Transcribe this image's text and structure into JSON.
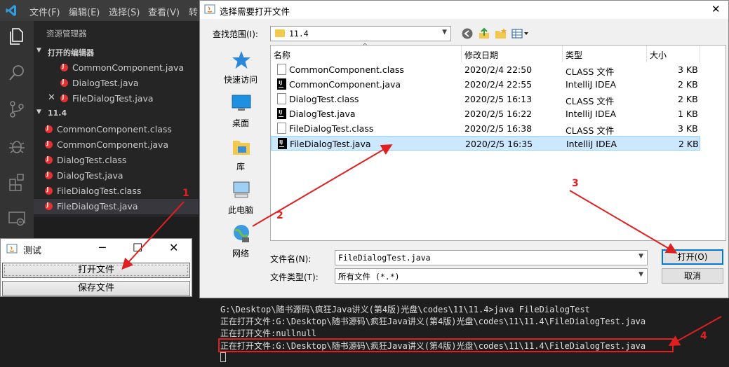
{
  "vscode": {
    "menu": [
      "文件(F)",
      "编辑(E)",
      "选择(S)",
      "查看(V)",
      "转"
    ],
    "explorer_title": "资源管理器",
    "open_editors": {
      "header": "打开的编辑器",
      "files": [
        "CommonComponent.java",
        "DialogTest.java",
        "FileDialogTest.java"
      ]
    },
    "folder": {
      "header": "11.4",
      "files": [
        "CommonComponent.class",
        "CommonComponent.java",
        "DialogTest.class",
        "DialogTest.java",
        "FileDialogTest.class",
        "FileDialogTest.java"
      ]
    },
    "terminal": [
      "G:\\Desktop\\随书源码\\疯狂Java讲义(第4版)光盘\\codes\\11\\11.4>java FileDialogTest",
      "正在打开文件:G:\\Desktop\\随书源码\\疯狂Java讲义(第4版)光盘\\codes\\11\\11.4\\FileDialogTest.java",
      "正在打开文件:nullnull",
      "正在打开文件:G:\\Desktop\\随书源码\\疯狂Java讲义(第4版)光盘\\codes\\11\\11.4\\FileDialogTest.java"
    ]
  },
  "mini": {
    "title": "测试",
    "controls": [
      "─",
      "☐",
      "✕"
    ],
    "open_label": "打开文件",
    "save_label": "保存文件"
  },
  "dialog": {
    "title": "选择需要打开文件",
    "close": "✕",
    "look_in_label": "查找范围(I):",
    "look_in_value": "11.4",
    "places": [
      "快速访问",
      "桌面",
      "库",
      "此电脑",
      "网络"
    ],
    "columns": [
      "名称",
      "修改日期",
      "类型",
      "大小"
    ],
    "files": [
      {
        "name": "CommonComponent.class",
        "date": "2020/2/4 22:50",
        "type": "CLASS 文件",
        "size": "3 KB",
        "icon": "doc"
      },
      {
        "name": "CommonComponent.java",
        "date": "2020/2/4 22:55",
        "type": "IntelliJ IDEA",
        "size": "2 KB",
        "icon": "ij"
      },
      {
        "name": "DialogTest.class",
        "date": "2020/2/5 16:13",
        "type": "CLASS 文件",
        "size": "2 KB",
        "icon": "doc"
      },
      {
        "name": "DialogTest.java",
        "date": "2020/2/5 16:22",
        "type": "IntelliJ IDEA",
        "size": "1 KB",
        "icon": "ij"
      },
      {
        "name": "FileDialogTest.class",
        "date": "2020/2/5 16:38",
        "type": "CLASS 文件",
        "size": "3 KB",
        "icon": "doc"
      },
      {
        "name": "FileDialogTest.java",
        "date": "2020/2/5 16:35",
        "type": "IntelliJ IDEA",
        "size": "2 KB",
        "icon": "ij"
      }
    ],
    "selected_index": 5,
    "filename_label": "文件名(N):",
    "filename_value": "FileDialogTest.java",
    "filetype_label": "文件类型(T):",
    "filetype_value": "所有文件 (*.*)",
    "open_btn": "打开(O)",
    "cancel_btn": "取消"
  },
  "annotations": [
    "1",
    "2",
    "3",
    "4"
  ],
  "colors": {
    "annotation": "#e02020",
    "selection": "#cce8ff",
    "vscode_bg": "#1e1e1e"
  }
}
